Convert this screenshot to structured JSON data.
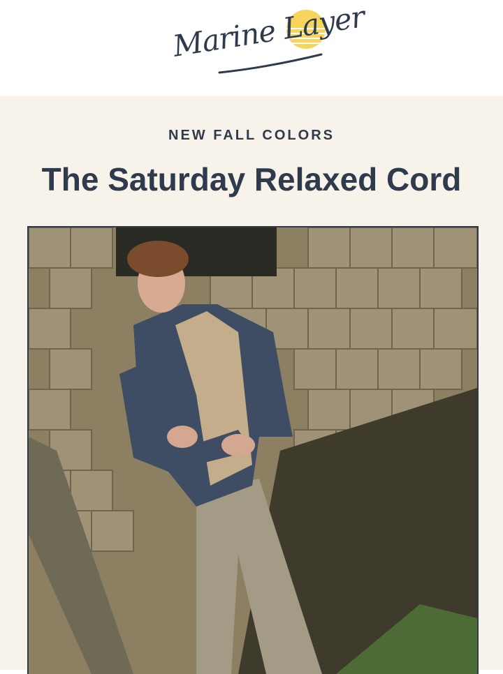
{
  "brand": {
    "logo_text": "Marine Layer",
    "sun_color": "#f7d55c",
    "ink_color": "#2f3b4c"
  },
  "hero": {
    "eyebrow": "NEW FALL COLORS",
    "title": "The Saturday Relaxed Cord",
    "background": "#f7f3ea"
  },
  "image": {
    "icon": "model-photo"
  }
}
